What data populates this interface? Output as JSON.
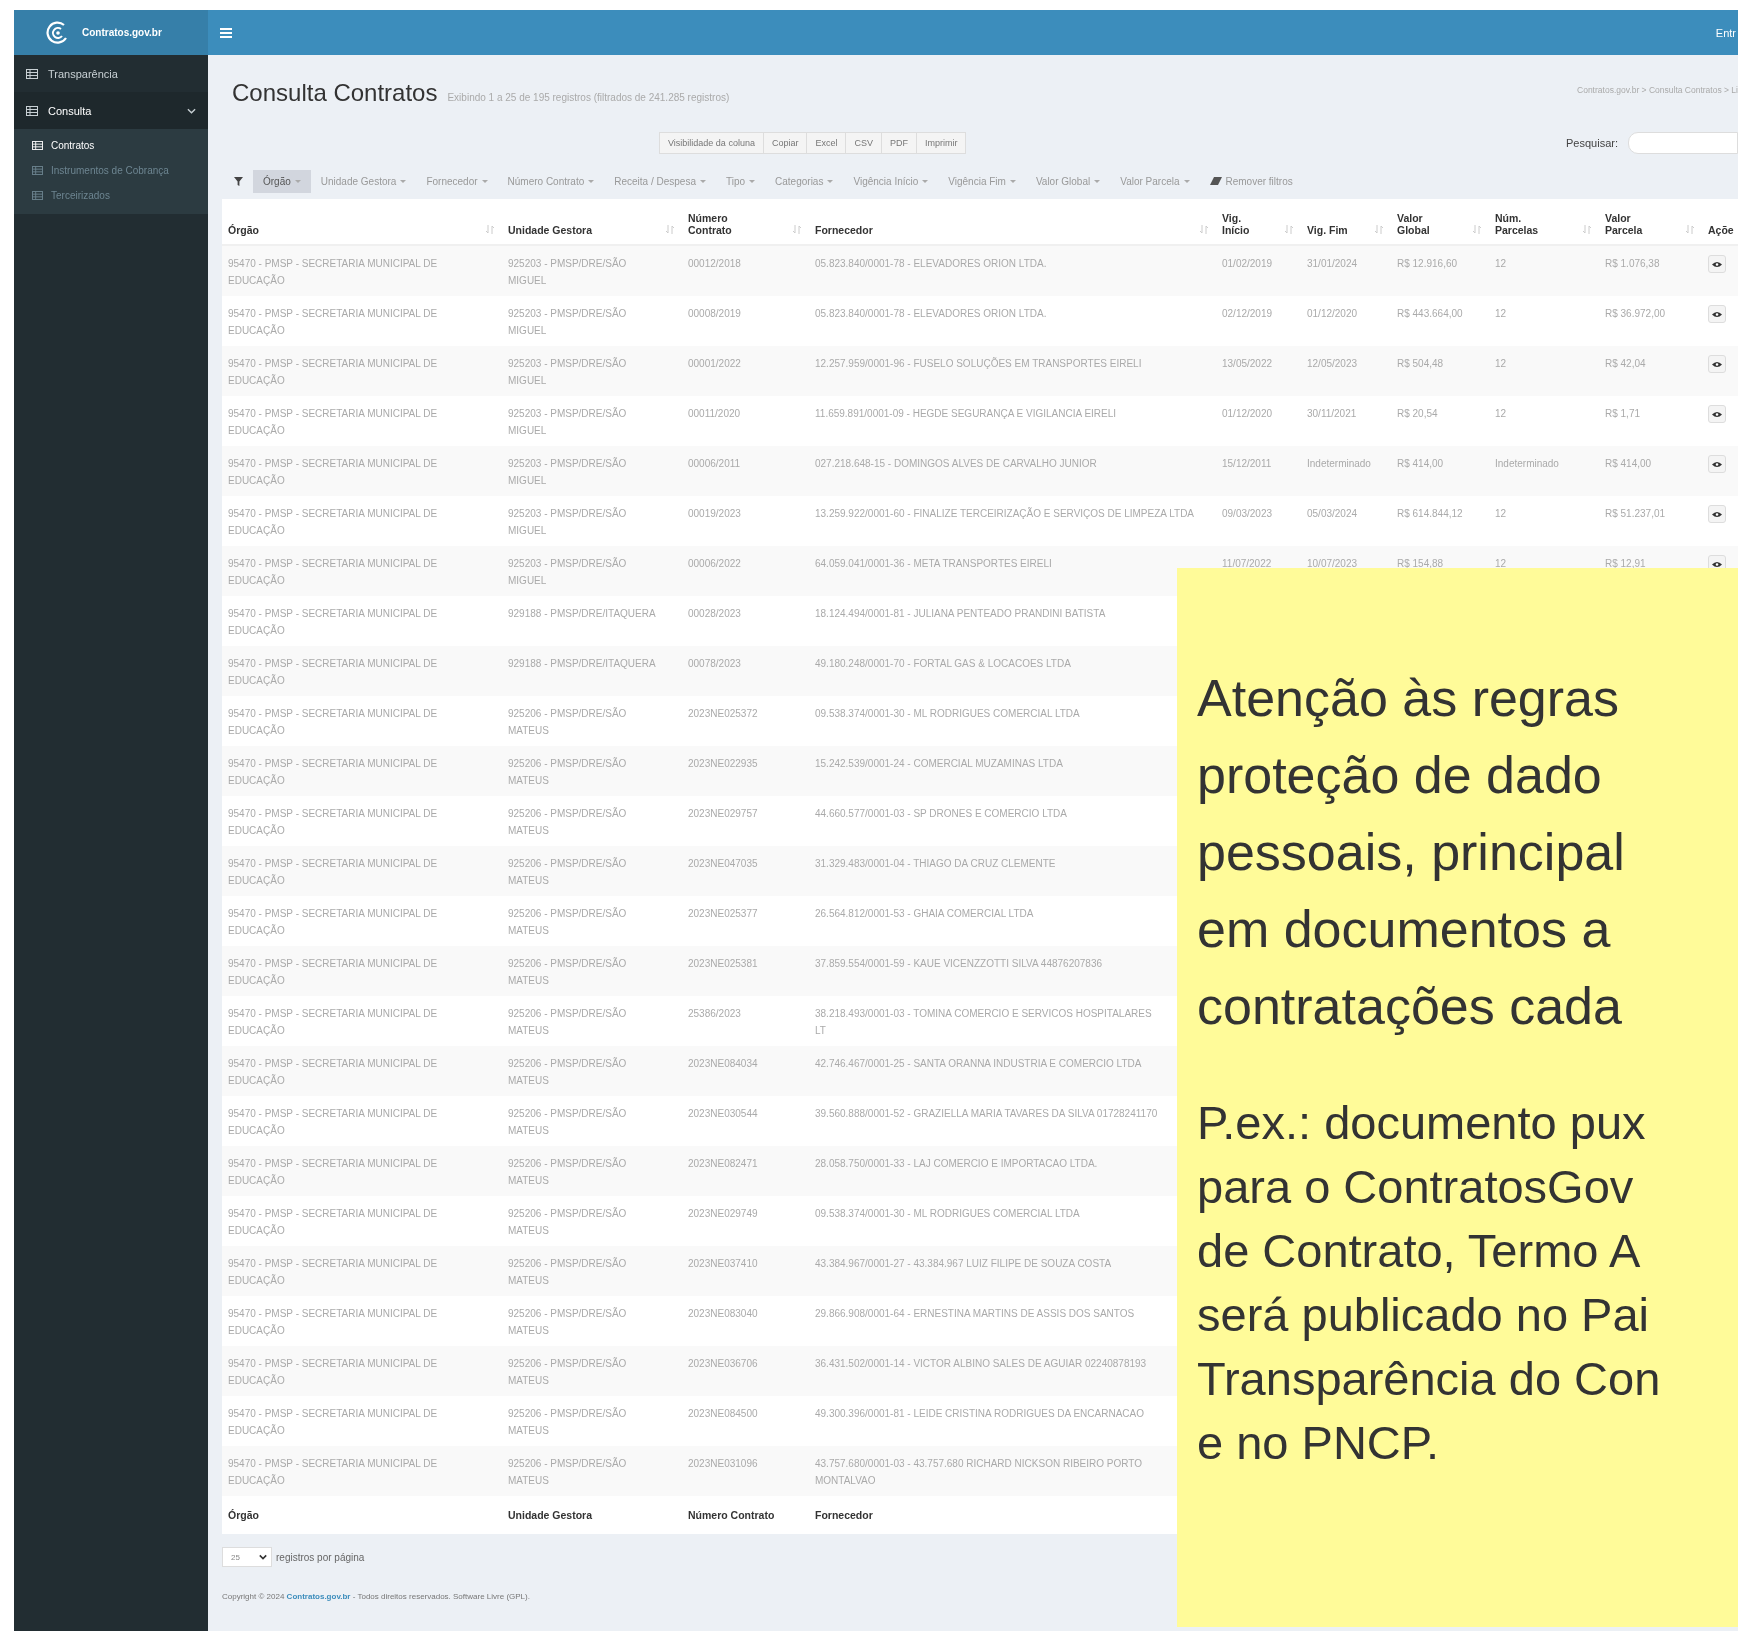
{
  "topbar": {
    "brand": "Contratos.gov.br",
    "right_text": "Entr"
  },
  "sidebar": {
    "items": [
      {
        "label": "Transparência",
        "selected": false
      },
      {
        "label": "Consulta",
        "selected": true,
        "expanded": true,
        "children": [
          {
            "label": "Contratos",
            "selected": true
          },
          {
            "label": "Instrumentos de Cobrança",
            "selected": false
          },
          {
            "label": "Terceirizados",
            "selected": false
          }
        ]
      }
    ]
  },
  "page": {
    "title": "Consulta Contratos",
    "subtitle": "Exibindo 1 a 25 de 195 registros (filtrados de 241.285 registros)",
    "breadcrumb": "Contratos.gov.br > Consulta Contratos > Li"
  },
  "export_buttons": [
    "Visibilidade da coluna",
    "Copiar",
    "Excel",
    "CSV",
    "PDF",
    "Imprimir"
  ],
  "search": {
    "label": "Pesquisar:"
  },
  "filters": [
    {
      "label": "Órgão",
      "active": true
    },
    {
      "label": "Unidade Gestora",
      "active": false
    },
    {
      "label": "Fornecedor",
      "active": false
    },
    {
      "label": "Número Contrato",
      "active": false
    },
    {
      "label": "Receita / Despesa",
      "active": false
    },
    {
      "label": "Tipo",
      "active": false
    },
    {
      "label": "Categorias",
      "active": false
    },
    {
      "label": "Vigência Início",
      "active": false
    },
    {
      "label": "Vigência Fim",
      "active": false
    },
    {
      "label": "Valor Global",
      "active": false
    },
    {
      "label": "Valor Parcela",
      "active": false
    }
  ],
  "remove_filters": "Remover filtros",
  "table": {
    "columns": [
      "Órgão",
      "Unidade Gestora",
      "Número Contrato",
      "Fornecedor",
      "Vig. Início",
      "Vig. Fim",
      "Valor Global",
      "Núm. Parcelas",
      "Valor Parcela",
      "Açõe"
    ],
    "rows": [
      {
        "cells": [
          "95470 - PMSP - SECRETARIA MUNICIPAL DE EDUCAÇÃO",
          "925203 - PMSP/DRE/SÃO MIGUEL",
          "00012/2018",
          "05.823.840/0001-78 - ELEVADORES ORION LTDA.",
          "01/02/2019",
          "31/01/2024",
          "R$ 12.916,60",
          "12",
          "R$ 1.076,38"
        ]
      },
      {
        "cells": [
          "95470 - PMSP - SECRETARIA MUNICIPAL DE EDUCAÇÃO",
          "925203 - PMSP/DRE/SÃO MIGUEL",
          "00008/2019",
          "05.823.840/0001-78 - ELEVADORES ORION LTDA.",
          "02/12/2019",
          "01/12/2020",
          "R$ 443.664,00",
          "12",
          "R$ 36.972,00"
        ]
      },
      {
        "cells": [
          "95470 - PMSP - SECRETARIA MUNICIPAL DE EDUCAÇÃO",
          "925203 - PMSP/DRE/SÃO MIGUEL",
          "00001/2022",
          "12.257.959/0001-96 - FUSELO SOLUÇÕES EM TRANSPORTES EIRELI",
          "13/05/2022",
          "12/05/2023",
          "R$ 504,48",
          "12",
          "R$ 42,04"
        ]
      },
      {
        "cells": [
          "95470 - PMSP - SECRETARIA MUNICIPAL DE EDUCAÇÃO",
          "925203 - PMSP/DRE/SÃO MIGUEL",
          "00011/2020",
          "11.659.891/0001-09 - HEGDE SEGURANÇA E VIGILANCIA EIRELI",
          "01/12/2020",
          "30/11/2021",
          "R$ 20,54",
          "12",
          "R$ 1,71"
        ]
      },
      {
        "cells": [
          "95470 - PMSP - SECRETARIA MUNICIPAL DE EDUCAÇÃO",
          "925203 - PMSP/DRE/SÃO MIGUEL",
          "00006/2011",
          "027.218.648-15 - DOMINGOS ALVES DE CARVALHO JUNIOR",
          "15/12/2011",
          "Indeterminado",
          "R$ 414,00",
          "Indeterminado",
          "R$ 414,00"
        ]
      },
      {
        "cells": [
          "95470 - PMSP - SECRETARIA MUNICIPAL DE EDUCAÇÃO",
          "925203 - PMSP/DRE/SÃO MIGUEL",
          "00019/2023",
          "13.259.922/0001-60 - FINALIZE TERCEIRIZAÇÃO E SERVIÇOS DE LIMPEZA LTDA",
          "09/03/2023",
          "05/03/2024",
          "R$ 614.844,12",
          "12",
          "R$ 51.237,01"
        ]
      },
      {
        "cells": [
          "95470 - PMSP - SECRETARIA MUNICIPAL DE EDUCAÇÃO",
          "925203 - PMSP/DRE/SÃO MIGUEL",
          "00006/2022",
          "64.059.041/0001-36 - META TRANSPORTES EIRELI",
          "11/07/2022",
          "10/07/2023",
          "R$ 154,88",
          "12",
          "R$ 12,91"
        ]
      },
      {
        "cells": [
          "95470 - PMSP - SECRETARIA MUNICIPAL DE EDUCAÇÃO",
          "929188 - PMSP/DRE/ITAQUERA",
          "00028/2023",
          "18.124.494/0001-81 - JULIANA PENTEADO PRANDINI BATISTA"
        ]
      },
      {
        "cells": [
          "95470 - PMSP - SECRETARIA MUNICIPAL DE EDUCAÇÃO",
          "929188 - PMSP/DRE/ITAQUERA",
          "00078/2023",
          "49.180.248/0001-70 - FORTAL GAS & LOCACOES LTDA"
        ]
      },
      {
        "cells": [
          "95470 - PMSP - SECRETARIA MUNICIPAL DE EDUCAÇÃO",
          "925206 - PMSP/DRE/SÃO MATEUS",
          "2023NE025372",
          "09.538.374/0001-30 - ML RODRIGUES COMERCIAL LTDA"
        ]
      },
      {
        "cells": [
          "95470 - PMSP - SECRETARIA MUNICIPAL DE EDUCAÇÃO",
          "925206 - PMSP/DRE/SÃO MATEUS",
          "2023NE022935",
          "15.242.539/0001-24 - COMERCIAL MUZAMINAS LTDA"
        ]
      },
      {
        "cells": [
          "95470 - PMSP - SECRETARIA MUNICIPAL DE EDUCAÇÃO",
          "925206 - PMSP/DRE/SÃO MATEUS",
          "2023NE029757",
          "44.660.577/0001-03 - SP DRONES E COMERCIO LTDA"
        ]
      },
      {
        "cells": [
          "95470 - PMSP - SECRETARIA MUNICIPAL DE EDUCAÇÃO",
          "925206 - PMSP/DRE/SÃO MATEUS",
          "2023NE047035",
          "31.329.483/0001-04 - THIAGO DA CRUZ CLEMENTE"
        ]
      },
      {
        "cells": [
          "95470 - PMSP - SECRETARIA MUNICIPAL DE EDUCAÇÃO",
          "925206 - PMSP/DRE/SÃO MATEUS",
          "2023NE025377",
          "26.564.812/0001-53 - GHAIA COMERCIAL LTDA"
        ]
      },
      {
        "cells": [
          "95470 - PMSP - SECRETARIA MUNICIPAL DE EDUCAÇÃO",
          "925206 - PMSP/DRE/SÃO MATEUS",
          "2023NE025381",
          "37.859.554/0001-59 - KAUE VICENZZOTTI SILVA 44876207836"
        ]
      },
      {
        "cells": [
          "95470 - PMSP - SECRETARIA MUNICIPAL DE EDUCAÇÃO",
          "925206 - PMSP/DRE/SÃO MATEUS",
          "25386/2023",
          "38.218.493/0001-03 - TOMINA COMERCIO E SERVICOS HOSPITALARES LT"
        ]
      },
      {
        "cells": [
          "95470 - PMSP - SECRETARIA MUNICIPAL DE EDUCAÇÃO",
          "925206 - PMSP/DRE/SÃO MATEUS",
          "2023NE084034",
          "42.746.467/0001-25 - SANTA ORANNA INDUSTRIA E COMERCIO LTDA"
        ]
      },
      {
        "cells": [
          "95470 - PMSP - SECRETARIA MUNICIPAL DE EDUCAÇÃO",
          "925206 - PMSP/DRE/SÃO MATEUS",
          "2023NE030544",
          "39.560.888/0001-52 - GRAZIELLA MARIA TAVARES DA SILVA 01728241170"
        ]
      },
      {
        "cells": [
          "95470 - PMSP - SECRETARIA MUNICIPAL DE EDUCAÇÃO",
          "925206 - PMSP/DRE/SÃO MATEUS",
          "2023NE082471",
          "28.058.750/0001-33 - LAJ COMERCIO E IMPORTACAO LTDA."
        ]
      },
      {
        "cells": [
          "95470 - PMSP - SECRETARIA MUNICIPAL DE EDUCAÇÃO",
          "925206 - PMSP/DRE/SÃO MATEUS",
          "2023NE029749",
          "09.538.374/0001-30 - ML RODRIGUES COMERCIAL LTDA"
        ]
      },
      {
        "cells": [
          "95470 - PMSP - SECRETARIA MUNICIPAL DE EDUCAÇÃO",
          "925206 - PMSP/DRE/SÃO MATEUS",
          "2023NE037410",
          "43.384.967/0001-27 - 43.384.967 LUIZ FILIPE DE SOUZA COSTA"
        ]
      },
      {
        "cells": [
          "95470 - PMSP - SECRETARIA MUNICIPAL DE EDUCAÇÃO",
          "925206 - PMSP/DRE/SÃO MATEUS",
          "2023NE083040",
          "29.866.908/0001-64 - ERNESTINA MARTINS DE ASSIS DOS SANTOS"
        ]
      },
      {
        "cells": [
          "95470 - PMSP - SECRETARIA MUNICIPAL DE EDUCAÇÃO",
          "925206 - PMSP/DRE/SÃO MATEUS",
          "2023NE036706",
          "36.431.502/0001-14 - VICTOR ALBINO SALES DE AGUIAR 02240878193"
        ]
      },
      {
        "cells": [
          "95470 - PMSP - SECRETARIA MUNICIPAL DE EDUCAÇÃO",
          "925206 - PMSP/DRE/SÃO MATEUS",
          "2023NE084500",
          "49.300.396/0001-81 - LEIDE CRISTINA RODRIGUES DA ENCARNACAO"
        ]
      },
      {
        "cells": [
          "95470 - PMSP - SECRETARIA MUNICIPAL DE EDUCAÇÃO",
          "925206 - PMSP/DRE/SÃO MATEUS",
          "2023NE031096",
          "43.757.680/0001-03 - 43.757.680 RICHARD NICKSON RIBEIRO PORTO MONTALVAO"
        ]
      }
    ],
    "footer_columns": [
      "Órgão",
      "Unidade Gestora",
      "Número Contrato",
      "Fornecedor"
    ]
  },
  "page_length": {
    "value": "25",
    "label": "registros por página"
  },
  "copyright": {
    "prefix": "Copyright © 2024",
    "link": "Contratos.gov.br",
    "suffix": "- Todos direitos reservados. Software Livre (GPL)."
  },
  "notice": {
    "heading_lines": [
      "Atenção às regras",
      "proteção de dado",
      "pessoais, principal",
      "em documentos a",
      "contratações cada"
    ],
    "body_lines": [
      "P.ex.: documento pux",
      "para o ContratosGov",
      "de Contrato, Termo A",
      "será publicado no Pai",
      "Transparência do Con",
      "e no PNCP."
    ]
  }
}
